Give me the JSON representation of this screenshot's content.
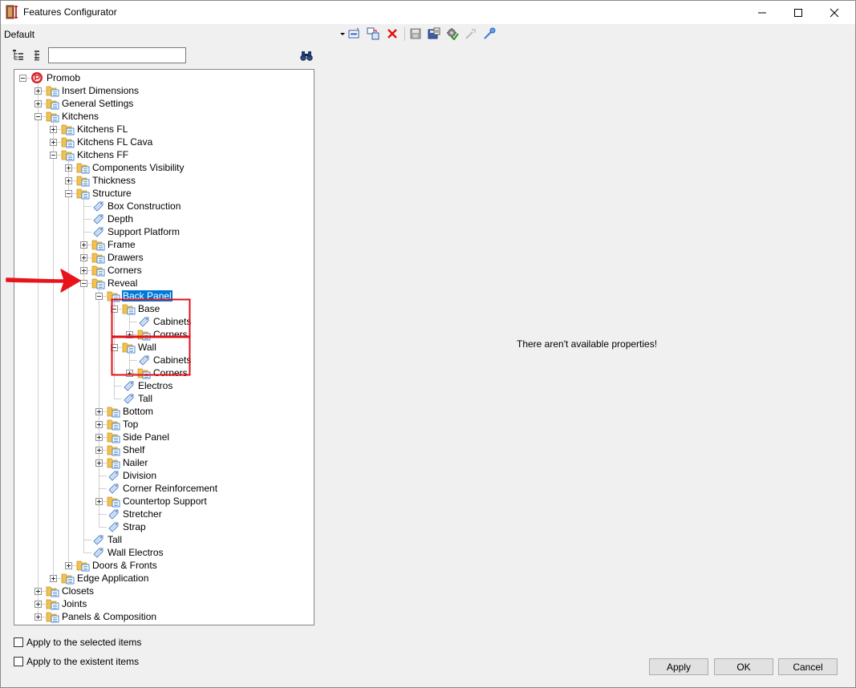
{
  "window": {
    "title": "Features Configurator",
    "icon": "configurator-app-icon"
  },
  "toolbar": {
    "preset_value": "Default",
    "icons": [
      "dropdown-arrow-icon",
      "new-item-icon",
      "copy-item-icon",
      "delete-icon",
      "save-icon",
      "save-as-icon",
      "gear-check-icon",
      "collapse-icon",
      "expand-icon"
    ]
  },
  "tree_toolbar": {
    "icons": [
      "tree-view-icon",
      "list-view-icon",
      "binoculars-icon"
    ],
    "search_value": ""
  },
  "tree": {
    "nodes": [
      {
        "label": "Promob",
        "depth": 0,
        "expander": "minus",
        "icon": "promob-logo-icon"
      },
      {
        "label": "Insert Dimensions",
        "depth": 1,
        "expander": "plus",
        "icon": "folder-icon"
      },
      {
        "label": "General Settings",
        "depth": 1,
        "expander": "plus",
        "icon": "folder-icon"
      },
      {
        "label": "Kitchens",
        "depth": 1,
        "expander": "minus",
        "icon": "folder-icon"
      },
      {
        "label": "Kitchens FL",
        "depth": 2,
        "expander": "plus",
        "icon": "folder-icon"
      },
      {
        "label": "Kitchens FL Cava",
        "depth": 2,
        "expander": "plus",
        "icon": "folder-icon"
      },
      {
        "label": "Kitchens FF",
        "depth": 2,
        "expander": "minus",
        "icon": "folder-icon"
      },
      {
        "label": "Components Visibility",
        "depth": 3,
        "expander": "plus",
        "icon": "folder-icon"
      },
      {
        "label": "Thickness",
        "depth": 3,
        "expander": "plus",
        "icon": "folder-icon"
      },
      {
        "label": "Structure",
        "depth": 3,
        "expander": "minus",
        "icon": "folder-icon"
      },
      {
        "label": "Box Construction",
        "depth": 4,
        "expander": "",
        "icon": "tag-icon"
      },
      {
        "label": "Depth",
        "depth": 4,
        "expander": "",
        "icon": "tag-icon"
      },
      {
        "label": "Support Platform",
        "depth": 4,
        "expander": "",
        "icon": "tag-icon"
      },
      {
        "label": "Frame",
        "depth": 4,
        "expander": "plus",
        "icon": "folder-icon"
      },
      {
        "label": "Drawers",
        "depth": 4,
        "expander": "plus",
        "icon": "folder-icon"
      },
      {
        "label": "Corners",
        "depth": 4,
        "expander": "plus",
        "icon": "folder-icon"
      },
      {
        "label": "Reveal",
        "depth": 4,
        "expander": "minus",
        "icon": "folder-icon"
      },
      {
        "label": "Back Panel",
        "depth": 5,
        "expander": "minus",
        "icon": "folder-icon",
        "selected": true
      },
      {
        "label": "Base",
        "depth": 6,
        "expander": "minus",
        "icon": "folder-icon"
      },
      {
        "label": "Cabinets",
        "depth": 7,
        "expander": "",
        "icon": "tag-icon"
      },
      {
        "label": "Corners",
        "depth": 7,
        "expander": "plus",
        "icon": "folder-icon"
      },
      {
        "label": "Wall",
        "depth": 6,
        "expander": "minus",
        "icon": "folder-icon"
      },
      {
        "label": "Cabinets",
        "depth": 7,
        "expander": "",
        "icon": "tag-icon"
      },
      {
        "label": "Corners",
        "depth": 7,
        "expander": "plus",
        "icon": "folder-icon"
      },
      {
        "label": "Electros",
        "depth": 6,
        "expander": "",
        "icon": "tag-icon"
      },
      {
        "label": "Tall",
        "depth": 6,
        "expander": "",
        "icon": "tag-icon"
      },
      {
        "label": "Bottom",
        "depth": 5,
        "expander": "plus",
        "icon": "folder-icon"
      },
      {
        "label": "Top",
        "depth": 5,
        "expander": "plus",
        "icon": "folder-icon"
      },
      {
        "label": "Side Panel",
        "depth": 5,
        "expander": "plus",
        "icon": "folder-icon"
      },
      {
        "label": "Shelf",
        "depth": 5,
        "expander": "plus",
        "icon": "folder-icon"
      },
      {
        "label": "Nailer",
        "depth": 5,
        "expander": "plus",
        "icon": "folder-icon"
      },
      {
        "label": "Division",
        "depth": 5,
        "expander": "",
        "icon": "tag-icon"
      },
      {
        "label": "Corner Reinforcement",
        "depth": 5,
        "expander": "",
        "icon": "tag-icon"
      },
      {
        "label": "Countertop Support",
        "depth": 5,
        "expander": "plus",
        "icon": "folder-icon"
      },
      {
        "label": "Stretcher",
        "depth": 5,
        "expander": "",
        "icon": "tag-icon"
      },
      {
        "label": "Strap",
        "depth": 5,
        "expander": "",
        "icon": "tag-icon"
      },
      {
        "label": "Tall",
        "depth": 4,
        "expander": "",
        "icon": "tag-icon"
      },
      {
        "label": "Wall Electros",
        "depth": 4,
        "expander": "",
        "icon": "tag-icon"
      },
      {
        "label": "Doors & Fronts",
        "depth": 3,
        "expander": "plus",
        "icon": "folder-icon"
      },
      {
        "label": "Edge Application",
        "depth": 2,
        "expander": "plus",
        "icon": "folder-icon"
      },
      {
        "label": "Closets",
        "depth": 1,
        "expander": "plus",
        "icon": "folder-icon"
      },
      {
        "label": "Joints",
        "depth": 1,
        "expander": "plus",
        "icon": "folder-icon"
      },
      {
        "label": "Panels & Composition",
        "depth": 1,
        "expander": "plus",
        "icon": "folder-icon"
      }
    ]
  },
  "properties": {
    "message": "There aren't available properties!"
  },
  "options": {
    "apply_selected_label": "Apply to the selected items",
    "apply_selected_checked": false,
    "apply_existent_label": "Apply to the existent items",
    "apply_existent_checked": false
  },
  "buttons": {
    "apply": "Apply",
    "ok": "OK",
    "cancel": "Cancel"
  },
  "annotation_colors": {
    "arrow": "#e8141c",
    "highlight_box": "#e0101a"
  },
  "colors": {
    "selection": "#0078d7",
    "folder": "#f2c14e"
  }
}
